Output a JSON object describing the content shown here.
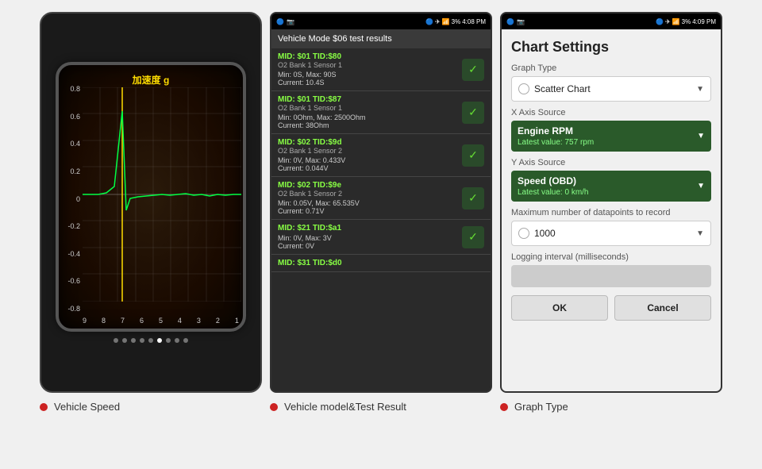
{
  "panel1": {
    "graph_label": "加速度 g",
    "y_labels": [
      "0.8",
      "0.6",
      "0.4",
      "0.2",
      "0",
      "-0.2",
      "-0.4",
      "-0.6",
      "-0.8"
    ],
    "x_labels": [
      "9",
      "8",
      "7",
      "6",
      "5",
      "4",
      "3",
      "2",
      "1"
    ],
    "dots": [
      0,
      0,
      0,
      0,
      0,
      1,
      0,
      0,
      0
    ]
  },
  "panel2": {
    "status_bar": {
      "left_icons": "🔵 📷",
      "right_icons": "🔵 ✈ 📶 3% 4:08 PM"
    },
    "header": "Vehicle Mode $06 test results",
    "items": [
      {
        "mid": "MID: $01 TID:$80",
        "sensor": "O2 Bank 1 Sensor 1",
        "min_max": "Min: 0S, Max: 90S",
        "current": "Current: 10.4S"
      },
      {
        "mid": "MID: $01 TID:$87",
        "sensor": "O2 Bank 1 Sensor 1",
        "min_max": "Min: 0Ohm, Max: 2500Ohm",
        "current": "Current: 38Ohm"
      },
      {
        "mid": "MID: $02 TID:$9d",
        "sensor": "O2 Bank 1 Sensor 2",
        "min_max": "Min: 0V, Max: 0.433V",
        "current": "Current: 0.044V"
      },
      {
        "mid": "MID: $02 TID:$9e",
        "sensor": "O2 Bank 1 Sensor 2",
        "min_max": "Min: 0.05V, Max: 65.535V",
        "current": "Current: 0.71V"
      },
      {
        "mid": "MID: $21 TID:$a1",
        "sensor": "",
        "min_max": "Min: 0V, Max: 3V",
        "current": "Current: 0V"
      },
      {
        "mid": "MID: $31 TID:$d0",
        "sensor": "",
        "min_max": "",
        "current": ""
      }
    ]
  },
  "panel3": {
    "status_bar": {
      "right_icons": "🔵 ✈ 📶 3% 4:09 PM"
    },
    "title": "Chart Settings",
    "graph_type_label": "Graph Type",
    "graph_type_value": "Scatter Chart",
    "x_axis_label": "X Axis Source",
    "x_axis_value": "Engine RPM",
    "x_axis_sub": "Latest value: 757 rpm",
    "y_axis_label": "Y Axis Source",
    "y_axis_value": "Speed (OBD)",
    "y_axis_sub": "Latest value: 0 km/h",
    "max_datapoints_label": "Maximum number of datapoints to record",
    "max_datapoints_value": "1000",
    "logging_label": "Logging interval (milliseconds)",
    "ok_label": "OK",
    "cancel_label": "Cancel"
  },
  "bottom_labels": {
    "label1": "Vehicle Speed",
    "label2": "Vehicle model&Test Result",
    "label3": "Graph Type"
  }
}
